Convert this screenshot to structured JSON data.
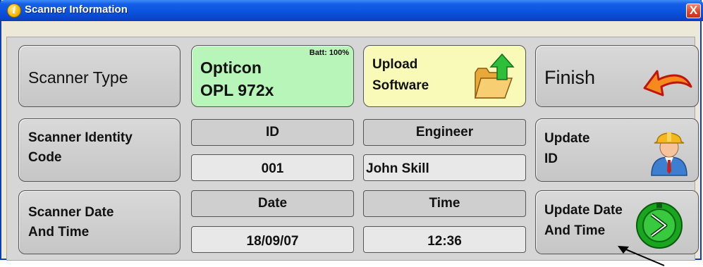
{
  "window": {
    "title": "Scanner Information",
    "close_label": "X",
    "titlebar_color": "#0b55e0"
  },
  "scanner_type": {
    "label": "Scanner Type",
    "model_line1": "Opticon",
    "model_line2": "OPL 972x",
    "battery": "Batt: 100%",
    "battery_level_percent": 100,
    "model_bg_color": "#b8f5b8"
  },
  "upload": {
    "label_line1": "Upload",
    "label_line2": "Software",
    "bg_color": "#fafab8",
    "icon": "folder-upload-icon"
  },
  "finish": {
    "label": "Finish",
    "icon": "back-arrow-icon"
  },
  "identity": {
    "label_line1": "Scanner Identity",
    "label_line2": "Code",
    "id_header": "ID",
    "id_value": "001",
    "engineer_header": "Engineer",
    "engineer_value": "John Skill"
  },
  "update_id": {
    "label_line1": "Update",
    "label_line2": "ID",
    "icon": "engineer-icon"
  },
  "datetime": {
    "label_line1": "Scanner Date",
    "label_line2": "And Time",
    "date_header": "Date",
    "date_value": "18/09/07",
    "time_header": "Time",
    "time_value": "12:36"
  },
  "update_datetime": {
    "label_line1": "Update Date",
    "label_line2": "And Time",
    "icon": "clock-icon"
  }
}
